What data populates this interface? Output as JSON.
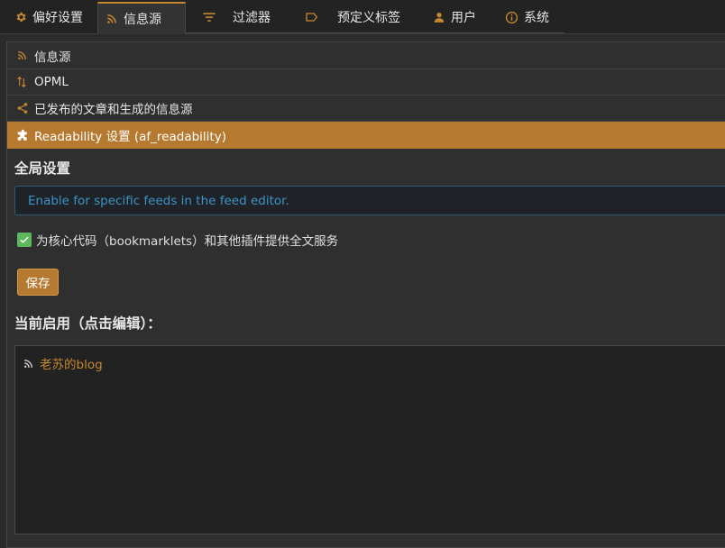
{
  "tabs": [
    {
      "label": "偏好设置",
      "icon": "gear-icon"
    },
    {
      "label": "信息源",
      "icon": "rss-icon"
    },
    {
      "label": "过滤器",
      "icon": "filter-icon"
    },
    {
      "label": "预定义标签",
      "icon": "label-icon"
    },
    {
      "label": "用户",
      "icon": "user-icon"
    },
    {
      "label": "系统",
      "icon": "info-icon"
    }
  ],
  "active_tab": "信息源",
  "accordion": [
    {
      "label": "信息源",
      "icon": "rss-icon"
    },
    {
      "label": "OPML",
      "icon": "import-export-icon"
    },
    {
      "label": "已发布的文章和生成的信息源",
      "icon": "share-icon"
    },
    {
      "label": "Readability 设置 (af_readability)",
      "icon": "puzzle-icon"
    }
  ],
  "settings": {
    "global_title": "全局设置",
    "info_text": "Enable for specific feeds in the feed editor.",
    "checkbox_label": "为核心代码（bookmarklets）和其他插件提供全文服务",
    "checkbox_checked": true,
    "save_label": "保存",
    "enabled_title": "当前启用（点击编辑）：",
    "enabled_feeds": [
      "老苏的blog"
    ]
  },
  "colors": {
    "accent": "#b57a30",
    "info_text": "#3d94c9",
    "checkbox": "#5cb85c",
    "background": "#2b2b2b"
  }
}
